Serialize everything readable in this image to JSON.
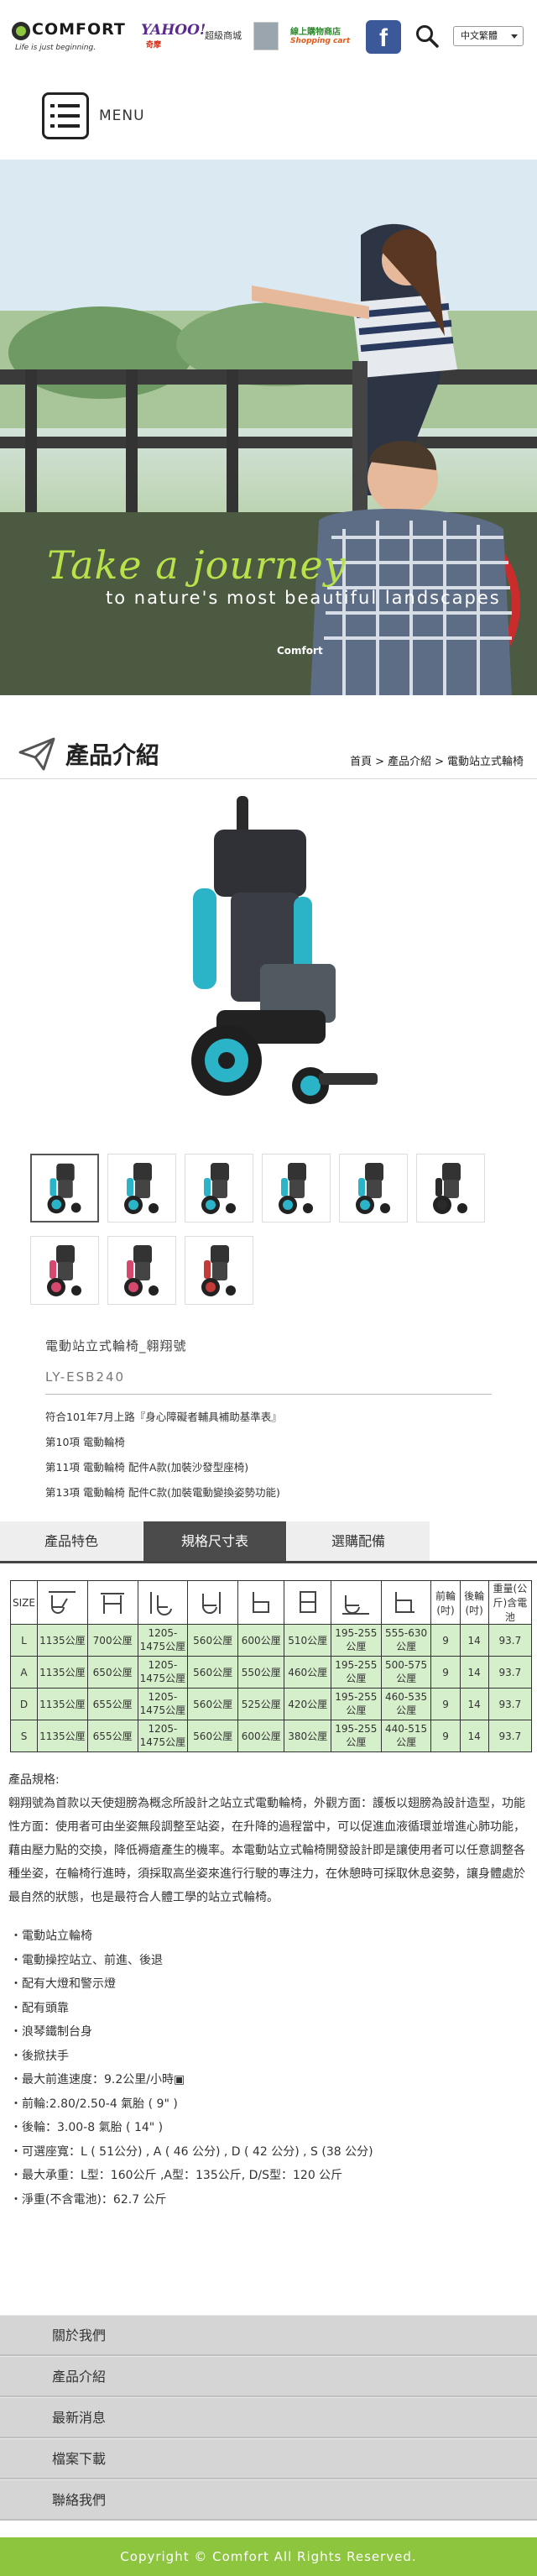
{
  "header": {
    "logo_word": "COMFORT",
    "logo_tagline": "Life is just beginning.",
    "yahoo_word": "YAHOO!",
    "yahoo_sub": "奇摩",
    "yahoo_label": "超級商城",
    "shop_title": "線上購物商店",
    "shop_sub": "Shopping cart",
    "facebook_glyph": "f",
    "language": "中文繁體"
  },
  "menu": {
    "label": "MENU"
  },
  "hero": {
    "title": "Take a journey",
    "subtitle": "to nature's most beautiful landscapes",
    "badge": "Comfort"
  },
  "section": {
    "title": "產品介紹",
    "breadcrumb": [
      "首頁",
      "產品介紹",
      "電動站立式輪椅"
    ],
    "breadcrumb_sep": ">"
  },
  "product": {
    "name": "電動站立式輪椅_翱翔號",
    "code": "LY-ESB240",
    "notes": [
      "符合101年7月上路『身心障礙者輔具補助基準表』",
      "第10項 電動輪椅",
      "第11項 電動輪椅 配件A款(加裝沙發型座椅)",
      "第13項 電動輪椅 配件C款(加裝電動變換姿勢功能)"
    ],
    "thumbnail_count": 9
  },
  "tabs": [
    {
      "label": "產品特色",
      "active": false
    },
    {
      "label": "規格尺寸表",
      "active": true
    },
    {
      "label": "選購配備",
      "active": false
    }
  ],
  "spec_table": {
    "first_header": "SIZE",
    "text_headers": [
      "前輪(吋)",
      "後輪(吋)",
      "重量(公斤)含電池"
    ],
    "rows": [
      [
        "L",
        "1135公厘",
        "700公厘",
        "1205-1475公厘",
        "560公厘",
        "600公厘",
        "510公厘",
        "195-255公厘",
        "555-630公厘",
        "9",
        "14",
        "93.7"
      ],
      [
        "A",
        "1135公厘",
        "650公厘",
        "1205-1475公厘",
        "560公厘",
        "550公厘",
        "460公厘",
        "195-255公厘",
        "500-575公厘",
        "9",
        "14",
        "93.7"
      ],
      [
        "D",
        "1135公厘",
        "655公厘",
        "1205-1475公厘",
        "560公厘",
        "525公厘",
        "420公厘",
        "195-255公厘",
        "460-535公厘",
        "9",
        "14",
        "93.7"
      ],
      [
        "S",
        "1135公厘",
        "655公厘",
        "1205-1475公厘",
        "560公厘",
        "600公厘",
        "380公厘",
        "195-255公厘",
        "440-515公厘",
        "9",
        "14",
        "93.7"
      ]
    ]
  },
  "spec_text": {
    "heading": "產品規格:",
    "body": "翱翔號為首款以天使翅膀為概念所設計之站立式電動輪椅，外觀方面：護板以翅膀為設計造型，功能性方面：使用者可由坐姿無段調整至站姿，在升降的過程當中，可以促進血液循環並增進心肺功能，藉由壓力點的交換，降低褥瘡產生的機率。本電動站立式輪椅開發設計即是讓使用者可以任意調整各種坐姿，在輪椅行進時，須採取高坐姿來進行行駛的專注力，在休憩時可採取休息姿勢，讓身體處於最自然的狀態，也是最符合人體工學的站立式輪椅。"
  },
  "features": [
    "・電動站立輪椅",
    "・電動操控站立、前進、後退",
    "・配有大燈和警示燈",
    "・配有頭靠",
    "・浪琴鐵制台身",
    "・後掀扶手",
    "・最大前進速度：9.2公里/小時▣",
    "・前輪:2.80/2.50-4 氣胎 ( 9\" )",
    "・後輪：3.00-8 氣胎 ( 14\" )",
    "・可選座寬：L ( 51公分) , A ( 46 公分) , D ( 42 公分) , S (38 公分)",
    "・最大承重：L型：160公斤 ,A型：135公斤, D/S型：120 公斤",
    "・淨重(不含電池)：62.7 公斤"
  ],
  "footer": {
    "nav": [
      "關於我們",
      "產品介紹",
      "最新消息",
      "檔案下載",
      "聯絡我們"
    ],
    "copyright": "Copyright © Comfort   All Rights Reserved."
  },
  "colors": {
    "brand_green": "#8dc53f",
    "table_row": "#d6efcb",
    "tab_active": "#4b4b4b",
    "facebook": "#3b5998",
    "wheel_teal": "#2bb3c8"
  },
  "icons": [
    "menu-icon",
    "search-icon",
    "paper-plane-icon",
    "facebook-icon",
    "chevron-down-icon"
  ]
}
